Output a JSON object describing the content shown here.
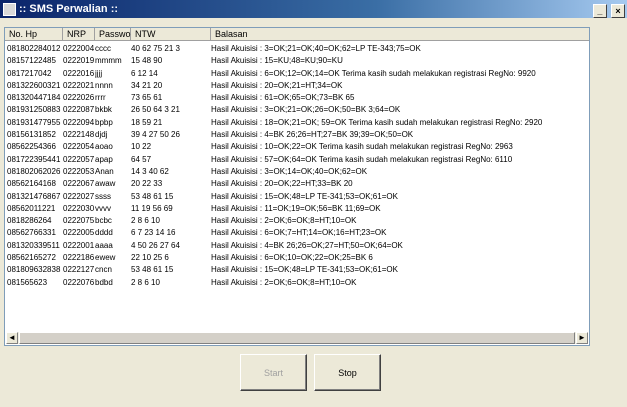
{
  "window": {
    "title": ":: SMS Perwalian ::",
    "controls": [
      "_",
      "×"
    ]
  },
  "table": {
    "columns": [
      "No. Hp",
      "NRP",
      "Password",
      "NTW",
      "Balasan"
    ],
    "rows": [
      [
        "081802284012",
        "0222004",
        "cccc",
        "40 62 75 21 3",
        "Hasil Akuisisi : 3=OK;21=OK;40=OK;62=LP TE-343;75=OK"
      ],
      [
        "08157122485",
        "0222019",
        "mmmm",
        "15 48 90",
        "Hasil Akuisisi : 15=KU;48=KU;90=KU"
      ],
      [
        "0817217042",
        "0222016",
        "jjjj",
        "6 12 14",
        "Hasil Akuisisi : 6=OK;12=OK;14=OK Terima kasih sudah melakukan registrasi  RegNo: 9920"
      ],
      [
        "081322600321",
        "0222021",
        "nnnn",
        "34 21 20",
        "Hasil Akuisisi : 20=OK;21=HT;34=OK"
      ],
      [
        "081320447184",
        "0222026",
        "rrrr",
        "73 65 61",
        "Hasil Akuisisi : 61=OK;65=OK;73=BK 65"
      ],
      [
        "081931250883",
        "0222087",
        "bkbk",
        "26 50 64 3 21",
        "Hasil Akuisisi : 3=OK;21=OK;26=OK;50=BK 3;64=OK"
      ],
      [
        "081931477955",
        "0222094",
        "bpbp",
        "18 59 21",
        "Hasil Akuisisi : 18=OK;21=OK; 59=OK Terima kasih sudah melakukan registrasi  RegNo: 2920"
      ],
      [
        "08156131852",
        "0222148",
        "djdj",
        "39 4 27 50 26",
        "Hasil Akuisisi : 4=BK 26;26=HT;27=BK 39;39=OK;50=OK"
      ],
      [
        "08562254366",
        "0222054",
        "aoao",
        "10 22",
        "Hasil Akuisisi : 10=OK;22=OK  Terima kasih sudah melakukan registrasi  RegNo: 2963"
      ],
      [
        "081722395441",
        "0222057",
        "apap",
        "64 57",
        "Hasil Akuisisi : 57=OK;64=OK  Terima kasih sudah melakukan registrasi  RegNo: 6110"
      ],
      [
        "081802062026",
        "0222053",
        "Anan",
        "14 3 40 62",
        "Hasil Akuisisi : 3=OK;14=OK;40=OK;62=OK"
      ],
      [
        "08562164168",
        "0222067",
        "awaw",
        "20 22 33",
        "Hasil Akuisisi : 20=OK;22=HT;33=BK 20"
      ],
      [
        "081321476867",
        "0222027",
        "ssss",
        "53 48 61 15",
        "Hasil Akuisisi : 15=OK;48=LP TE-341;53=OK;61=OK"
      ],
      [
        "08562011221",
        "0222030",
        "vvvv",
        "11 19 56 69",
        "Hasil Akuisisi : 11=OK;19=OK;56=BK 11;69=OK"
      ],
      [
        "0818286264",
        "0222075",
        "bcbc",
        "2 8 6 10",
        "Hasil Akuisisi : 2=OK;6=OK;8=HT;10=OK"
      ],
      [
        "08562766331",
        "0222005",
        "dddd",
        "6 7 23 14 16",
        "Hasil Akuisisi : 6=OK;7=HT;14=OK;16=HT;23=OK"
      ],
      [
        "081320339511",
        "0222001",
        "aaaa",
        "4 50 26 27 64",
        "Hasil Akuisisi : 4=BK 26;26=OK;27=HT;50=OK;64=OK"
      ],
      [
        "08562165272",
        "0222186",
        "ewew",
        "22 10 25 6",
        "Hasil Akuisisi : 6=OK;10=OK;22=OK;25=BK 6"
      ],
      [
        "081809632838",
        "0222127",
        "cncn",
        "53 48 61 15",
        "Hasil Akuisisi : 15=OK;48=LP TE-341;53=OK;61=OK"
      ],
      [
        "081565623",
        "0222076",
        "bdbd",
        "2 8 6 10",
        "Hasil Akuisisi : 2=OK;6=OK;8=HT;10=OK"
      ]
    ]
  },
  "scrollbar": {
    "left_arrow": "◄",
    "right_arrow": "►"
  },
  "buttons": {
    "start_label": "Start",
    "stop_label": "Stop"
  }
}
